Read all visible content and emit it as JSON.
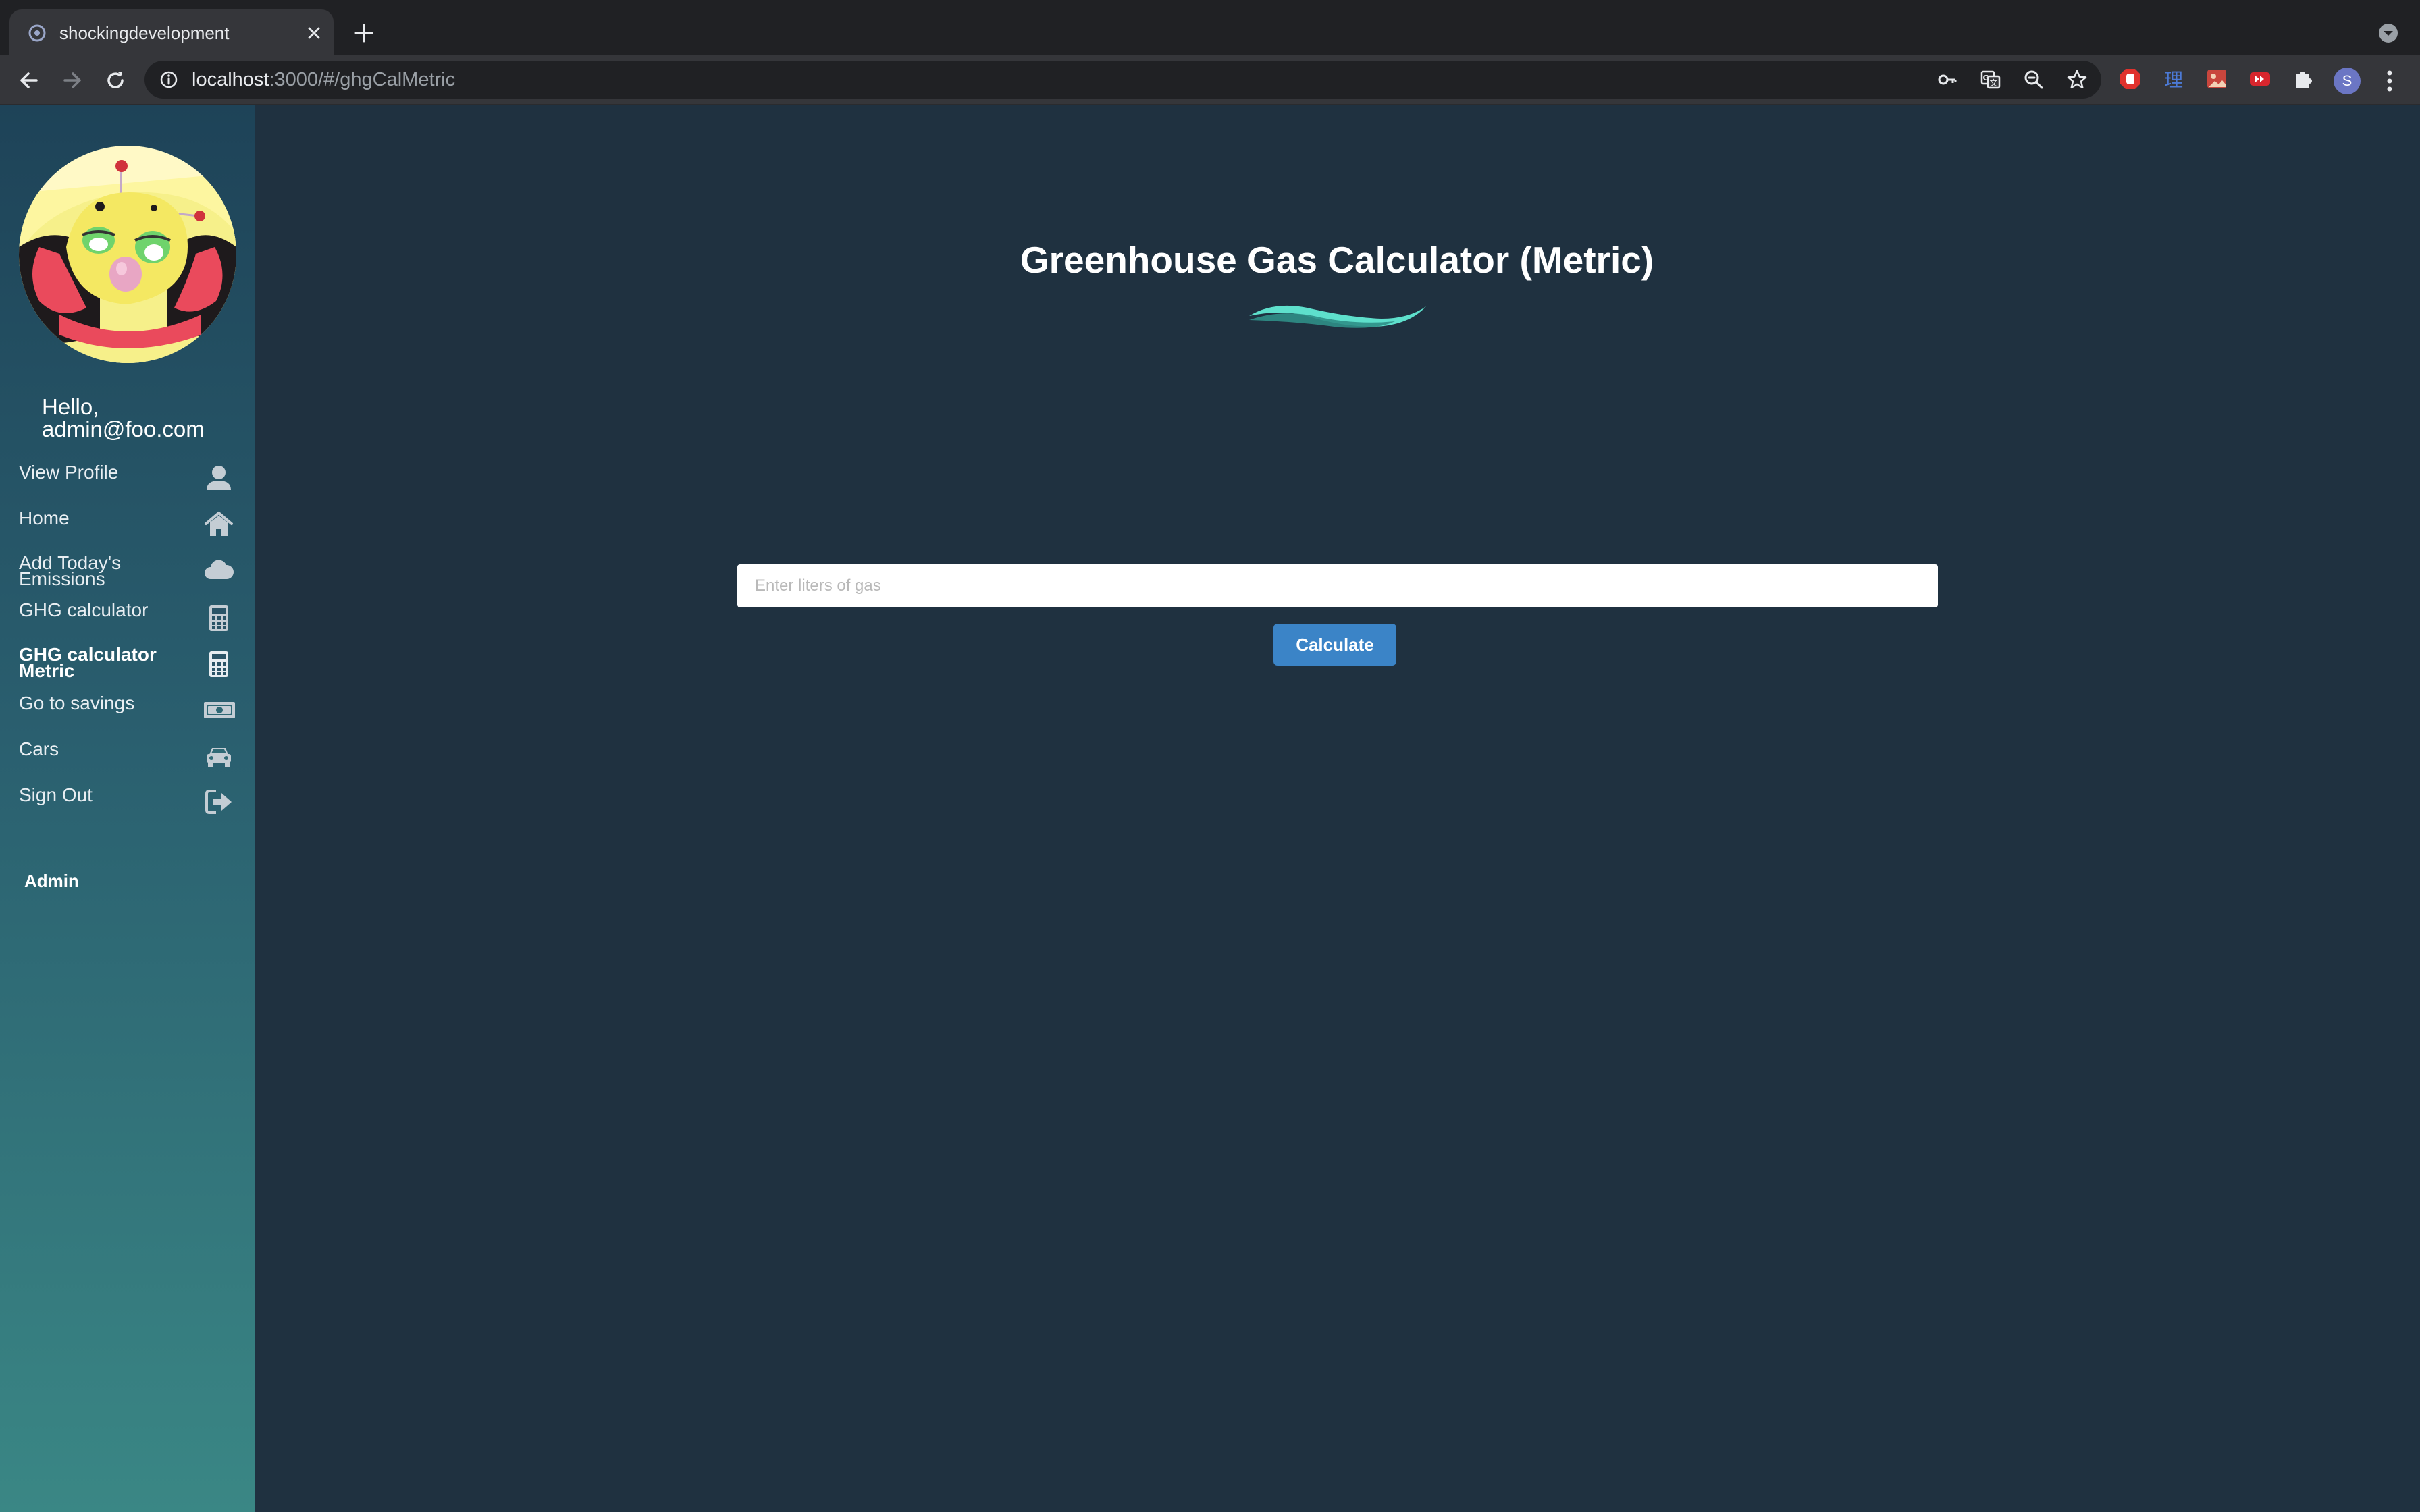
{
  "browser": {
    "tab_title": "shockingdevelopment",
    "url_host": "localhost",
    "url_rest": ":3000/#/ghgCalMetric",
    "profile_initial": "S",
    "extension_icons": [
      "key-icon",
      "translate-icon",
      "zoom-icon",
      "star-icon",
      "adblock-icon",
      "kanji-icon",
      "photo-icon",
      "video-icon",
      "puzzle-icon"
    ]
  },
  "sidebar": {
    "greeting_line1": "Hello,",
    "greeting_line2": "admin@foo.com",
    "items": [
      {
        "label_line1": "View Profile",
        "label_line2": "",
        "icon": "user-icon",
        "active": false
      },
      {
        "label_line1": "Home",
        "label_line2": "",
        "icon": "home-icon",
        "active": false
      },
      {
        "label_line1": "Add Today's",
        "label_line2": "Emissions",
        "icon": "cloud-icon",
        "active": false
      },
      {
        "label_line1": "GHG calculator",
        "label_line2": "",
        "icon": "calculator-icon",
        "active": false
      },
      {
        "label_line1": "GHG calculator",
        "label_line2": "Metric",
        "icon": "calculator-icon",
        "active": true
      },
      {
        "label_line1": "Go to savings",
        "label_line2": "",
        "icon": "money-icon",
        "active": false
      },
      {
        "label_line1": "Cars",
        "label_line2": "",
        "icon": "car-icon",
        "active": false
      },
      {
        "label_line1": "Sign Out",
        "label_line2": "",
        "icon": "sign-out-icon",
        "active": false
      }
    ],
    "admin_label": "Admin"
  },
  "main": {
    "title": "Greenhouse Gas Calculator (Metric)",
    "input_placeholder": "Enter liters of gas",
    "input_value": "",
    "calculate_label": "Calculate"
  },
  "colors": {
    "background": "#1f3140",
    "accent_wave": "#5ee0cc",
    "button": "#3b84c7"
  }
}
